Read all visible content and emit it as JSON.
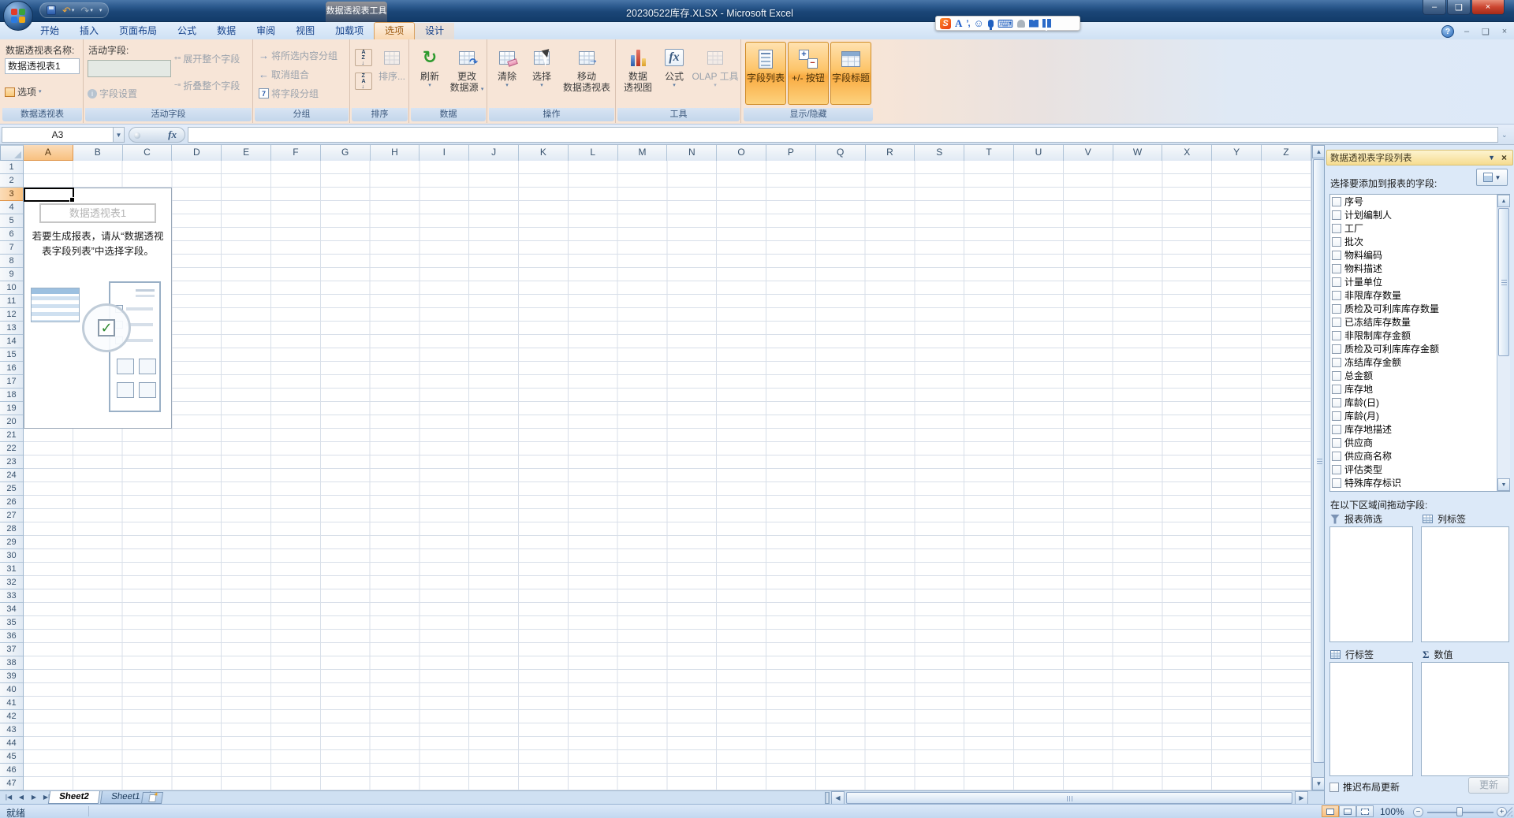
{
  "window": {
    "title": "20230522库存.XLSX - Microsoft Excel",
    "contextual_tool_label": "数据透视表工具"
  },
  "ribbon_tabs": [
    {
      "label": "开始"
    },
    {
      "label": "插入"
    },
    {
      "label": "页面布局"
    },
    {
      "label": "公式"
    },
    {
      "label": "数据"
    },
    {
      "label": "审阅"
    },
    {
      "label": "视图"
    },
    {
      "label": "加载项"
    },
    {
      "label": "选项",
      "active": true,
      "contextual": true
    },
    {
      "label": "设计",
      "contextual": true
    }
  ],
  "ribbon": {
    "pivot_group": {
      "label": "数据透视表",
      "name_label": "数据透视表名称:",
      "name_value": "数据透视表1",
      "options_label": "选项"
    },
    "active_field_group": {
      "label": "活动字段",
      "field_label": "活动字段:",
      "field_value": "",
      "settings_label": "字段设置",
      "expand_label": "展开整个字段",
      "collapse_label": "折叠整个字段"
    },
    "group_group": {
      "label": "分组",
      "items": [
        "将所选内容分组",
        "取消组合",
        "将字段分组"
      ]
    },
    "sort_group": {
      "label": "排序",
      "sort_label": "排序..."
    },
    "data_group": {
      "label": "数据",
      "refresh_label": "刷新",
      "change_source_lines": [
        "更改",
        "数据源"
      ]
    },
    "actions_group": {
      "label": "操作",
      "clear_label": "清除",
      "select_label": "选择",
      "move_lines": [
        "移动",
        "数据透视表"
      ]
    },
    "tools_group": {
      "label": "工具",
      "pivotchart_lines": [
        "数据",
        "透视图"
      ],
      "formulas_label": "公式",
      "olap_label": "OLAP 工具"
    },
    "show_hide_group": {
      "label": "显示/隐藏",
      "toggles": [
        "字段列表",
        "+/- 按钮",
        "字段标题"
      ]
    }
  },
  "formula_bar": {
    "cell_reference": "A3",
    "formula_value": ""
  },
  "grid": {
    "columns": [
      "A",
      "B",
      "C",
      "D",
      "E",
      "F",
      "G",
      "H",
      "I",
      "J",
      "K",
      "L",
      "M",
      "N",
      "O",
      "P",
      "Q",
      "R",
      "S",
      "T",
      "U",
      "V",
      "W",
      "X",
      "Y",
      "Z"
    ],
    "row_count": 47,
    "selected_cell": "A3",
    "selected_column": "A",
    "selected_row": 3
  },
  "pivot_placeholder": {
    "title": "数据透视表1",
    "message_lines": [
      "若要生成报表，请从“数据透视",
      "表字段列表”中选择字段。"
    ]
  },
  "field_list_pane": {
    "title": "数据透视表字段列表",
    "choose_label": "选择要添加到报表的字段:",
    "fields": [
      "序号",
      "计划编制人",
      "工厂",
      "批次",
      "物料编码",
      "物料描述",
      "计量单位",
      "非限库存数量",
      "质检及可利库库存数量",
      "已冻结库存数量",
      "非限制库存金额",
      "质检及可利库库存金额",
      "冻结库存金额",
      "总金额",
      "库存地",
      "库龄(日)",
      "库龄(月)",
      "库存地描述",
      "供应商",
      "供应商名称",
      "评估类型",
      "特殊库存标识"
    ],
    "drag_label": "在以下区域间拖动字段:",
    "areas": {
      "report_filter": "报表筛选",
      "column_labels": "列标签",
      "row_labels": "行标签",
      "values": "数值"
    },
    "defer_label": "推迟布局更新",
    "update_label": "更新"
  },
  "sheet_bar": {
    "tabs": [
      {
        "label": "Sheet2",
        "active": true
      },
      {
        "label": "Sheet1",
        "active": false
      }
    ]
  },
  "status_bar": {
    "mode": "就绪",
    "zoom_level": "100%"
  }
}
